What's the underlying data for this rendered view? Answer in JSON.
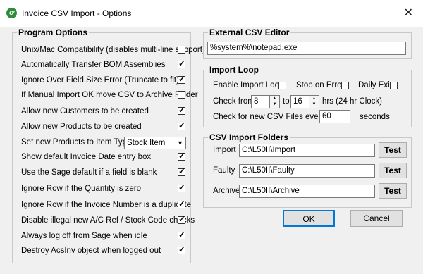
{
  "window": {
    "title": "Invoice CSV Import - Options",
    "app_icon_glyph": "ơ",
    "close_glyph": "✕"
  },
  "program_options": {
    "label": "Program Options",
    "items": [
      {
        "label": "Unix/Mac Compatibility (disables multi-line support)",
        "checked": false
      },
      {
        "label": "Automatically Transfer BOM Assemblies",
        "checked": true
      },
      {
        "label": "Ignore Over Field Size Error (Truncate to fit)",
        "checked": true
      },
      {
        "label": "If Manual Import OK move CSV to Archive Folder",
        "checked": false
      },
      {
        "label": "Allow new Customers to be created",
        "checked": true
      },
      {
        "label": "Allow new Products to be created",
        "checked": true
      },
      {
        "label": "Set new Products to Item Type",
        "select": "Stock Item"
      },
      {
        "label": "Show default Invoice Date entry box",
        "checked": true
      },
      {
        "label": "Use the Sage default if a field is blank",
        "checked": true
      },
      {
        "label": "Ignore Row if the Quantity is zero",
        "checked": true
      },
      {
        "label": "Ignore Row if the Invoice Number is a duplicate",
        "checked": true
      },
      {
        "label": "Disable illegal new A/C Ref / Stock Code checks",
        "checked": true
      },
      {
        "label": "Always log off from Sage when idle",
        "checked": true
      },
      {
        "label": "Destroy AcsInv object when logged out",
        "checked": true
      }
    ]
  },
  "editor": {
    "label": "External CSV Editor",
    "value": "%system%\\notepad.exe"
  },
  "import_loop": {
    "label": "Import Loop",
    "enable_label": "Enable Import Loop",
    "enable_checked": false,
    "stop_label": "Stop on Error",
    "stop_checked": false,
    "daily_label": "Daily Exit",
    "daily_checked": false,
    "check_from_label": "Check from",
    "from_value": "8",
    "to_label": "to",
    "to_value": "16",
    "hrs_label": "hrs  (24 hr Clock)",
    "every_label": "Check for new CSV Files every",
    "every_value": "60",
    "seconds_label": "seconds"
  },
  "folders": {
    "label": "CSV Import Folders",
    "rows": [
      {
        "label": "Import",
        "value": "C:\\L50II\\Import",
        "button": "Test"
      },
      {
        "label": "Faulty",
        "value": "C:\\L50II\\Faulty",
        "button": "Test"
      },
      {
        "label": "Archive",
        "value": "C:\\L50II\\Archive",
        "button": "Test"
      }
    ]
  },
  "buttons": {
    "ok": "OK",
    "cancel": "Cancel"
  }
}
